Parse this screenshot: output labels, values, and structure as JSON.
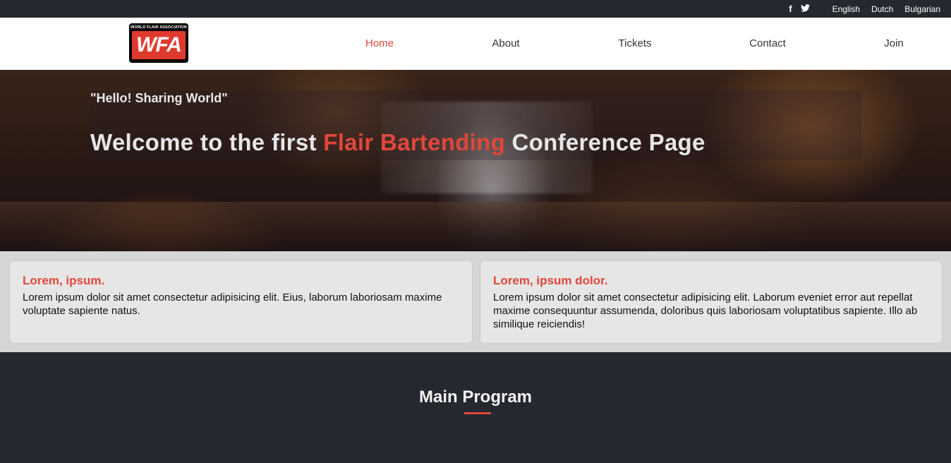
{
  "topbar": {
    "social": [
      {
        "icon": "facebook-icon",
        "glyph": "f"
      },
      {
        "icon": "twitter-icon",
        "glyph": "🐦"
      }
    ],
    "languages": [
      "English",
      "Dutch",
      "Bulgarian"
    ]
  },
  "logo": {
    "top_text": "WORLD FLAIR ASSOCIATION",
    "main_text": "WFA"
  },
  "nav": {
    "items": [
      "Home",
      "About",
      "Tickets",
      "Contact",
      "Join"
    ],
    "active": "Home"
  },
  "hero": {
    "tagline": "\"Hello! Sharing World\"",
    "headline_before": "Welcome to the first ",
    "headline_accent": "Flair Bartending",
    "headline_after": " Conference Page"
  },
  "cards": [
    {
      "title": "Lorem, ipsum.",
      "text": "Lorem ipsum dolor sit amet consectetur adipisicing elit. Eius, laborum laboriosam maxime voluptate sapiente natus."
    },
    {
      "title": "Lorem, ipsum dolor.",
      "text": "Lorem ipsum dolor sit amet consectetur adipisicing elit. Laborum eveniet error aut repellat maxime consequuntur assumenda, doloribus quis laboriosam voluptatibus sapiente. Illo ab similique reiciendis!"
    }
  ],
  "program": {
    "title": "Main Program"
  },
  "colors": {
    "accent": "#e0473a",
    "dark": "#262830"
  }
}
